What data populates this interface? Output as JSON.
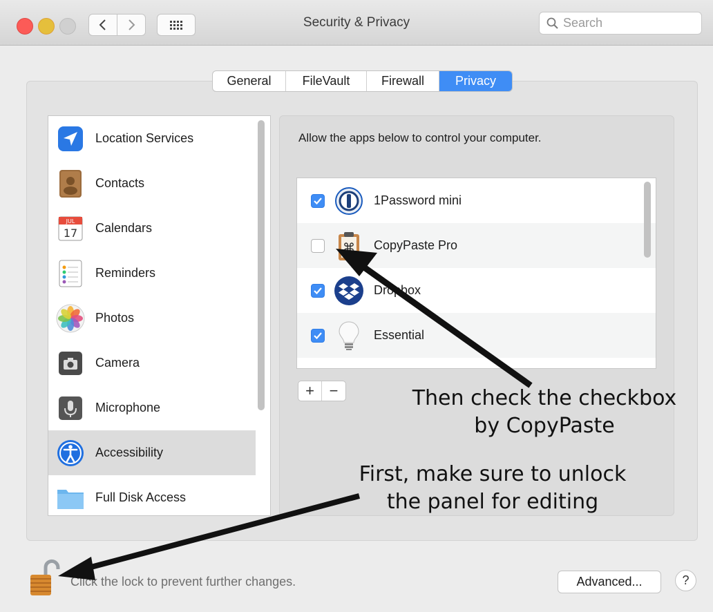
{
  "window": {
    "title": "Security & Privacy",
    "search_placeholder": "Search"
  },
  "tabs": [
    {
      "label": "General",
      "active": false
    },
    {
      "label": "FileVault",
      "active": false
    },
    {
      "label": "Firewall",
      "active": false
    },
    {
      "label": "Privacy",
      "active": true
    }
  ],
  "sidebar": {
    "items": [
      {
        "label": "Location Services",
        "icon": "location-arrow-icon",
        "selected": false
      },
      {
        "label": "Contacts",
        "icon": "contacts-book-icon",
        "selected": false
      },
      {
        "label": "Calendars",
        "icon": "calendar-icon",
        "selected": false,
        "icon_month": "JUL",
        "icon_day": "17"
      },
      {
        "label": "Reminders",
        "icon": "reminders-list-icon",
        "selected": false
      },
      {
        "label": "Photos",
        "icon": "photos-flower-icon",
        "selected": false
      },
      {
        "label": "Camera",
        "icon": "camera-icon",
        "selected": false
      },
      {
        "label": "Microphone",
        "icon": "microphone-icon",
        "selected": false
      },
      {
        "label": "Accessibility",
        "icon": "accessibility-icon",
        "selected": true
      },
      {
        "label": "Full Disk Access",
        "icon": "folder-icon",
        "selected": false
      }
    ]
  },
  "content": {
    "description": "Allow the apps below to control your computer.",
    "apps": [
      {
        "label": "1Password mini",
        "checked": true,
        "icon": "onepassword-icon"
      },
      {
        "label": "CopyPaste Pro",
        "checked": false,
        "icon": "copypaste-clipboard-icon"
      },
      {
        "label": "Dropbox",
        "checked": true,
        "icon": "dropbox-icon"
      },
      {
        "label": "Essential",
        "checked": true,
        "icon": "lightbulb-icon"
      }
    ],
    "add_label": "+",
    "remove_label": "−"
  },
  "footer": {
    "lock_text": "Click the lock to prevent further changes.",
    "advanced_label": "Advanced...",
    "help_label": "?"
  },
  "annotations": {
    "checkbox_note_line1": "Then check the checkbox",
    "checkbox_note_line2": "by CopyPaste",
    "unlock_note_line1": "First, make sure to unlock",
    "unlock_note_line2": "the panel for editing"
  },
  "colors": {
    "accent": "#3f8df5",
    "selection": "#dcdcdc",
    "close": "#fc5b57",
    "minimize": "#e5bf3c"
  }
}
